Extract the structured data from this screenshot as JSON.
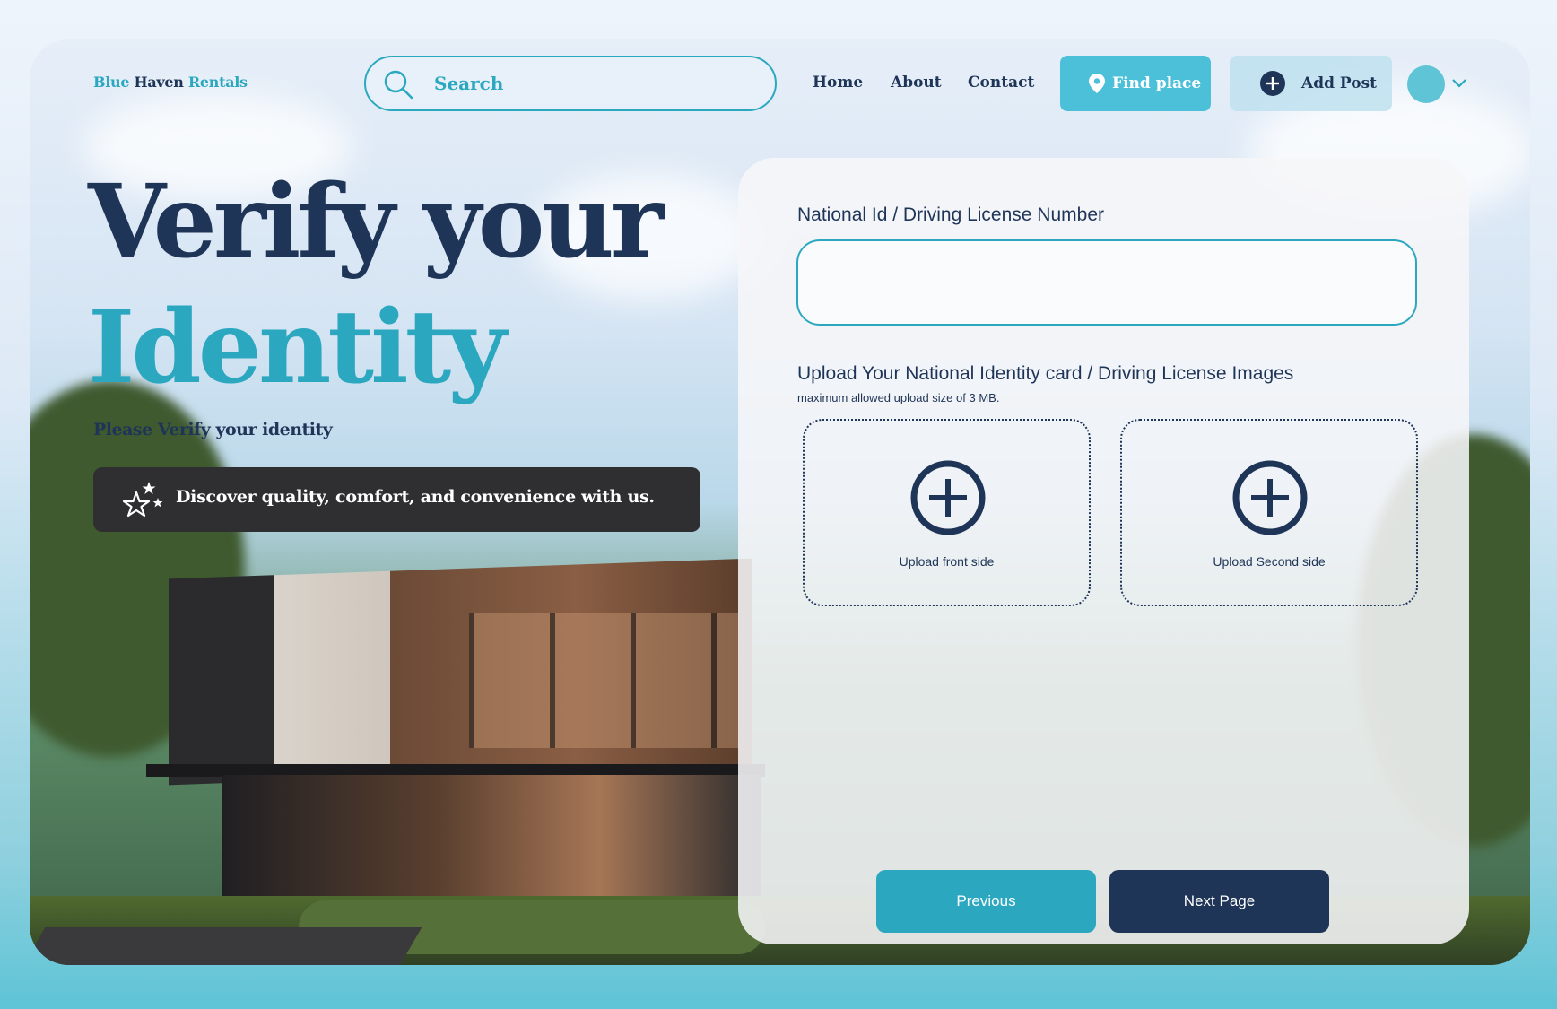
{
  "brand": {
    "word1": "Blue",
    "word2": "Haven",
    "word3": "Rentals"
  },
  "search": {
    "placeholder": "Search"
  },
  "nav": {
    "home": "Home",
    "about": "About",
    "contact": "Contact"
  },
  "actions": {
    "find_place": "Find place",
    "add_post": "Add Post"
  },
  "hero": {
    "line1": "Verify your",
    "line2": "Identity",
    "subtitle": "Please Verify your identity",
    "tagline": "Discover quality, comfort, and convenience with us."
  },
  "form": {
    "id_label": "National Id / Driving License Number",
    "id_value": "",
    "upload_label": "Upload Your National Identity card / Driving License Images",
    "upload_hint": "maximum allowed upload size of 3 MB.",
    "upload_front": "Upload front side",
    "upload_back": "Upload Second side",
    "previous": "Previous",
    "next": "Next Page"
  },
  "icons": {
    "search": "search-icon",
    "find_place": "map-pin-icon",
    "add_post": "plus-circle-icon",
    "dropdown": "chevron-down-icon",
    "tagline": "stars-icon",
    "upload": "plus-circle-icon"
  },
  "colors": {
    "navy": "#1f3558",
    "teal": "#2ba8c0",
    "light_teal": "#4cc0d8",
    "dark_bar": "#2f2f31"
  }
}
